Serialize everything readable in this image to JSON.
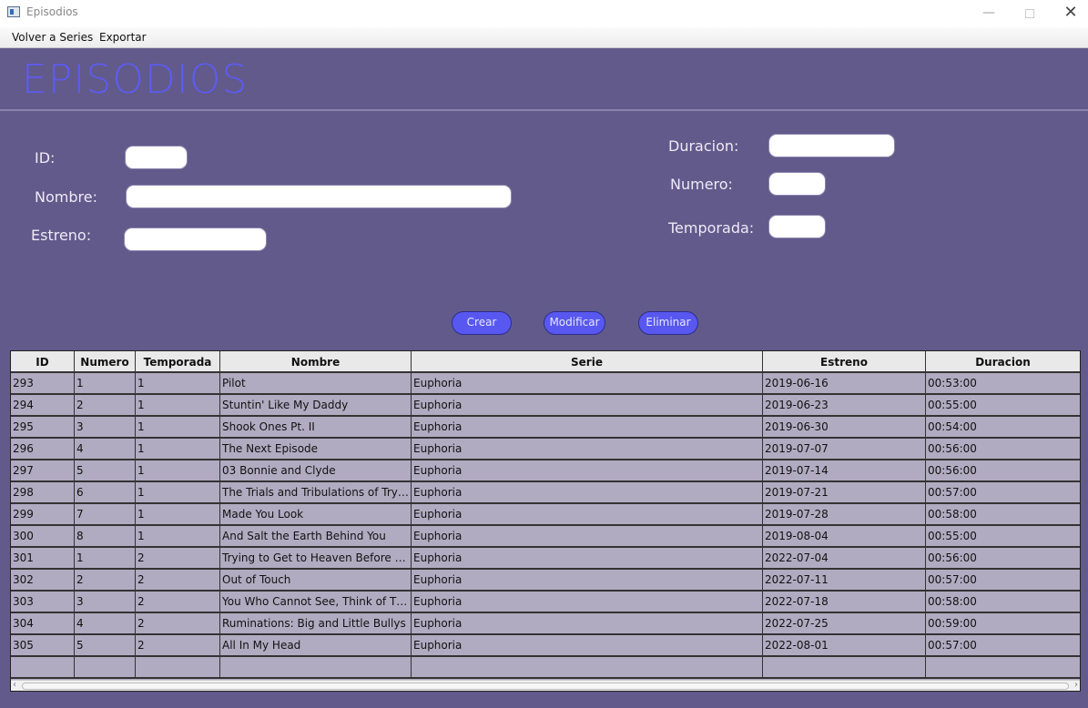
{
  "window": {
    "title": "Episodios",
    "minimize": "—",
    "close": "✕"
  },
  "menu": {
    "items": [
      "Volver a Series",
      "Exportar"
    ]
  },
  "page": {
    "title": "EPISODIOS"
  },
  "form": {
    "id_label": "ID:",
    "nombre_label": "Nombre:",
    "estreno_label": "Estreno:",
    "duracion_label": "Duracion:",
    "numero_label": "Numero:",
    "temporada_label": "Temporada:",
    "id_value": "",
    "nombre_value": "",
    "estreno_value": "",
    "duracion_value": "",
    "numero_value": "",
    "temporada_value": ""
  },
  "buttons": {
    "crear": "Crear",
    "modificar": "Modificar",
    "eliminar": "Eliminar"
  },
  "table": {
    "columns": [
      "ID",
      "Numero",
      "Temporada",
      "Nombre",
      "Serie",
      "Estreno",
      "Duracion"
    ],
    "rows": [
      [
        "293",
        "1",
        "1",
        "Pilot",
        "Euphoria",
        "2019-06-16",
        "00:53:00"
      ],
      [
        "294",
        "2",
        "1",
        "Stuntin' Like My Daddy",
        "Euphoria",
        "2019-06-23",
        "00:55:00"
      ],
      [
        "295",
        "3",
        "1",
        "Shook Ones Pt. II",
        "Euphoria",
        "2019-06-30",
        "00:54:00"
      ],
      [
        "296",
        "4",
        "1",
        "The Next Episode",
        "Euphoria",
        "2019-07-07",
        "00:56:00"
      ],
      [
        "297",
        "5",
        "1",
        "03 Bonnie and Clyde",
        "Euphoria",
        "2019-07-14",
        "00:56:00"
      ],
      [
        "298",
        "6",
        "1",
        "The Trials and Tribulations of Trying ...",
        "Euphoria",
        "2019-07-21",
        "00:57:00"
      ],
      [
        "299",
        "7",
        "1",
        "Made You Look",
        "Euphoria",
        "2019-07-28",
        "00:58:00"
      ],
      [
        "300",
        "8",
        "1",
        "And Salt the Earth Behind You",
        "Euphoria",
        "2019-08-04",
        "00:55:00"
      ],
      [
        "301",
        "1",
        "2",
        "Trying to Get to Heaven Before They...",
        "Euphoria",
        "2022-07-04",
        "00:56:00"
      ],
      [
        "302",
        "2",
        "2",
        "Out of Touch",
        "Euphoria",
        "2022-07-11",
        "00:57:00"
      ],
      [
        "303",
        "3",
        "2",
        "You Who Cannot See, Think of Thos...",
        "Euphoria",
        "2022-07-18",
        "00:58:00"
      ],
      [
        "304",
        "4",
        "2",
        "Ruminations: Big and Little Bullys",
        "Euphoria",
        "2022-07-25",
        "00:59:00"
      ],
      [
        "305",
        "5",
        "2",
        "All In My Head",
        "Euphoria",
        "2022-08-01",
        "00:57:00"
      ]
    ]
  },
  "colors": {
    "background": "#625a8a",
    "accent": "#5858f0",
    "title": "#5c5cf2",
    "table_bg": "#b1abc1"
  }
}
